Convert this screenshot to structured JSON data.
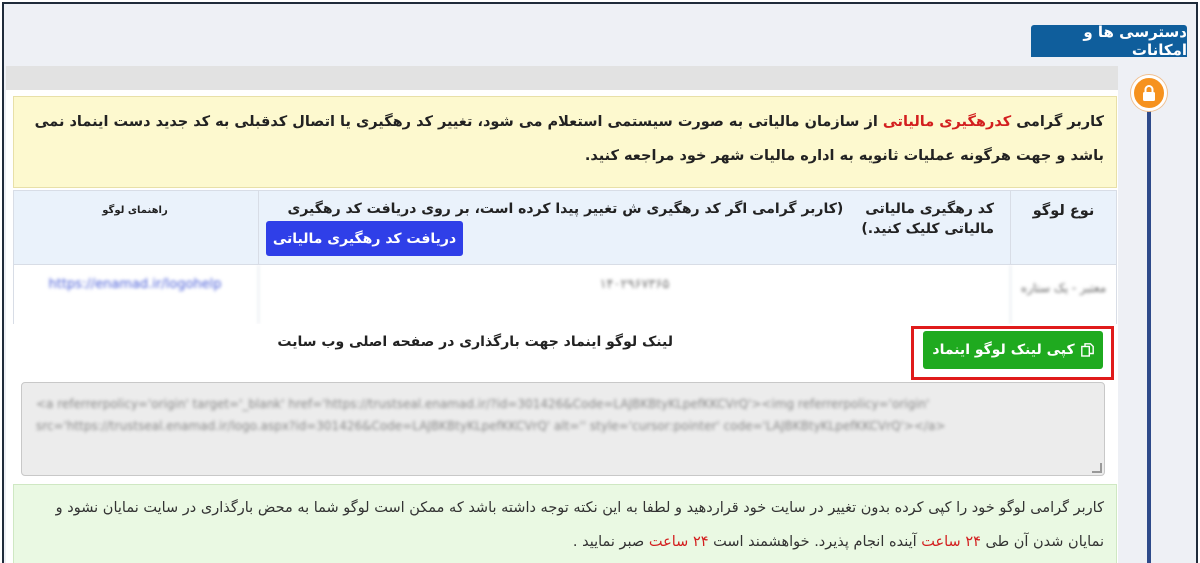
{
  "section": {
    "title": "دسترسی ها و امکانات"
  },
  "warning": {
    "prefix": "کاربر گرامی",
    "highlight": "کدرهگیری مالیاتی",
    "suffix": "از سازمان مالیاتی به صورت سیستمی استعلام می شود، تغییر کد رهگیری یا اتصال کدقبلی به کد جدید دست اینماد نمی باشد و جهت هرگونه عملیات ثانویه به اداره مالیات شهر خود مراجعه کنید."
  },
  "table": {
    "headers": {
      "logo_type": "نوع لوگو",
      "tax_code_label": "کد رهگیری مالیاتی",
      "tax_code_note": "(کاربر گرامی اگر کد رهگیری ش تغییر پیدا کرده است، بر روی دریافت کد رهگیری مالیاتی کلیک کنید.)",
      "guide": "راهنمای لوگو"
    },
    "get_code_button": "دریافت کد رهگیری مالیاتی",
    "row": {
      "logo_type": "معتبر - یک ستاره",
      "tax_code": "۱۴۰۲۹۶۷۳۶۵",
      "guide_link": "https://enamad.ir/logohelp"
    }
  },
  "copy": {
    "label": "لینک لوگو اینماد جهت بارگذاری در صفحه اصلی وب سایت",
    "button": "کپی لینک لوگو اینماد"
  },
  "code_text": "<a referrerpolicy='origin' target='_blank' href='https://trustseal.enamad.ir/?id=301426&Code=LAJBKBtyKLpefKKCVrQ'><img referrerpolicy='origin' src='https://trustseal.enamad.ir/logo.aspx?id=301426&Code=LAJBKBtyKLpefKKCVrQ' alt='' style='cursor:pointer' code='LAJBKBtyKLpefKKCVrQ'></a>",
  "note": {
    "part1": "کاربر گرامی لوگو خود را کپی کرده بدون تغییر در سایت خود قراردهید و لطفا به این نکته توجه داشته باشد که ممکن است لوگو شما به محض بارگذاری در سایت نمایان نشود و نمایان شدن آن طی",
    "hours1": "۲۴ ساعت",
    "part2": "آینده انجام پذیرد. خواهشمند است",
    "hours2": "۲۴ ساعت",
    "part3": "صبر نمایید ."
  }
}
